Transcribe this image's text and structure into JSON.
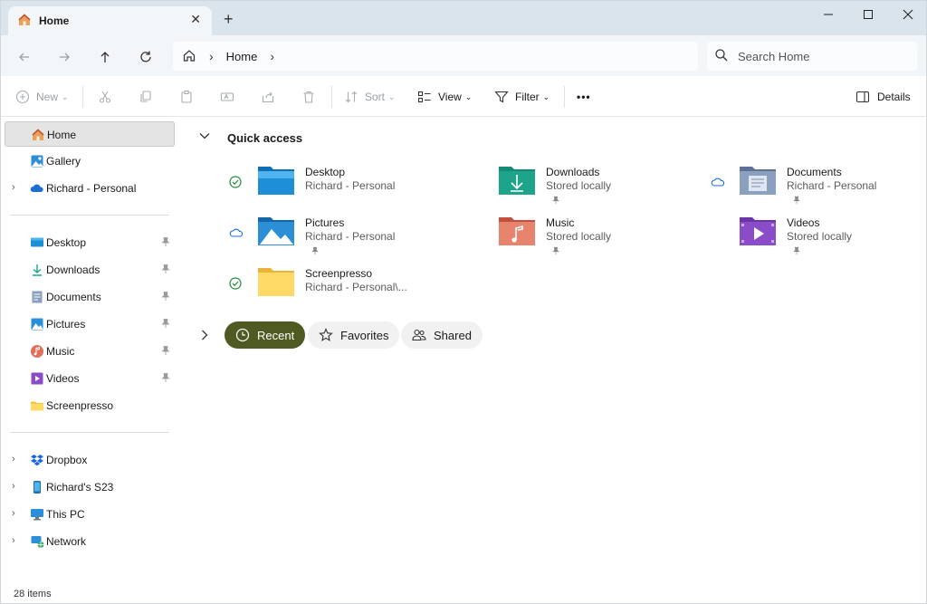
{
  "tab": {
    "title": "Home",
    "close": "✕",
    "new_tab": "+"
  },
  "window_controls": {
    "minimize": "—",
    "maximize": "☐",
    "close": "✕"
  },
  "address": {
    "path_label": "Home",
    "chevron": "›",
    "search_placeholder": "Search Home"
  },
  "commands": {
    "new": "New",
    "sort": "Sort",
    "view": "View",
    "filter": "Filter",
    "more": "•••",
    "details": "Details"
  },
  "sidebar": {
    "top": [
      {
        "label": "Home",
        "icon": "home-icon",
        "selected": true
      },
      {
        "label": "Gallery",
        "icon": "gallery-icon"
      },
      {
        "label": "Richard - Personal",
        "icon": "onedrive-icon",
        "expandable": true
      }
    ],
    "pinned": [
      {
        "label": "Desktop",
        "icon": "desktop-folder-icon"
      },
      {
        "label": "Downloads",
        "icon": "downloads-icon"
      },
      {
        "label": "Documents",
        "icon": "documents-icon"
      },
      {
        "label": "Pictures",
        "icon": "pictures-icon"
      },
      {
        "label": "Music",
        "icon": "music-icon"
      },
      {
        "label": "Videos",
        "icon": "videos-icon"
      },
      {
        "label": "Screenpresso",
        "icon": "folder-icon"
      }
    ],
    "locations": [
      {
        "label": "Dropbox",
        "icon": "dropbox-icon"
      },
      {
        "label": "Richard's S23",
        "icon": "phone-icon"
      },
      {
        "label": "This PC",
        "icon": "pc-icon"
      },
      {
        "label": "Network",
        "icon": "network-icon"
      }
    ]
  },
  "quick_access": {
    "title": "Quick access",
    "items": [
      {
        "name": "Desktop",
        "sub": "Richard - Personal",
        "status": "synced",
        "pinned": false,
        "color": "#1e8fd6"
      },
      {
        "name": "Downloads",
        "sub": "Stored locally",
        "status": "none",
        "pinned": true,
        "color": "#1ea48a"
      },
      {
        "name": "Documents",
        "sub": "Richard - Personal",
        "status": "cloud",
        "pinned": true,
        "color": "#6e84a8"
      },
      {
        "name": "Pictures",
        "sub": "Richard - Personal",
        "status": "cloud",
        "pinned": true,
        "color": "#2a8fd6"
      },
      {
        "name": "Music",
        "sub": "Stored locally",
        "status": "none",
        "pinned": true,
        "color": "#e0705a"
      },
      {
        "name": "Videos",
        "sub": "Stored locally",
        "status": "none",
        "pinned": true,
        "color": "#8a4cc9"
      },
      {
        "name": "Screenpresso",
        "sub": "Richard - Personal\\...",
        "status": "synced",
        "pinned": false,
        "color": "#f5c542"
      }
    ]
  },
  "pills": {
    "recent": "Recent",
    "favorites": "Favorites",
    "shared": "Shared"
  },
  "status_bar": {
    "count": "28 items"
  }
}
